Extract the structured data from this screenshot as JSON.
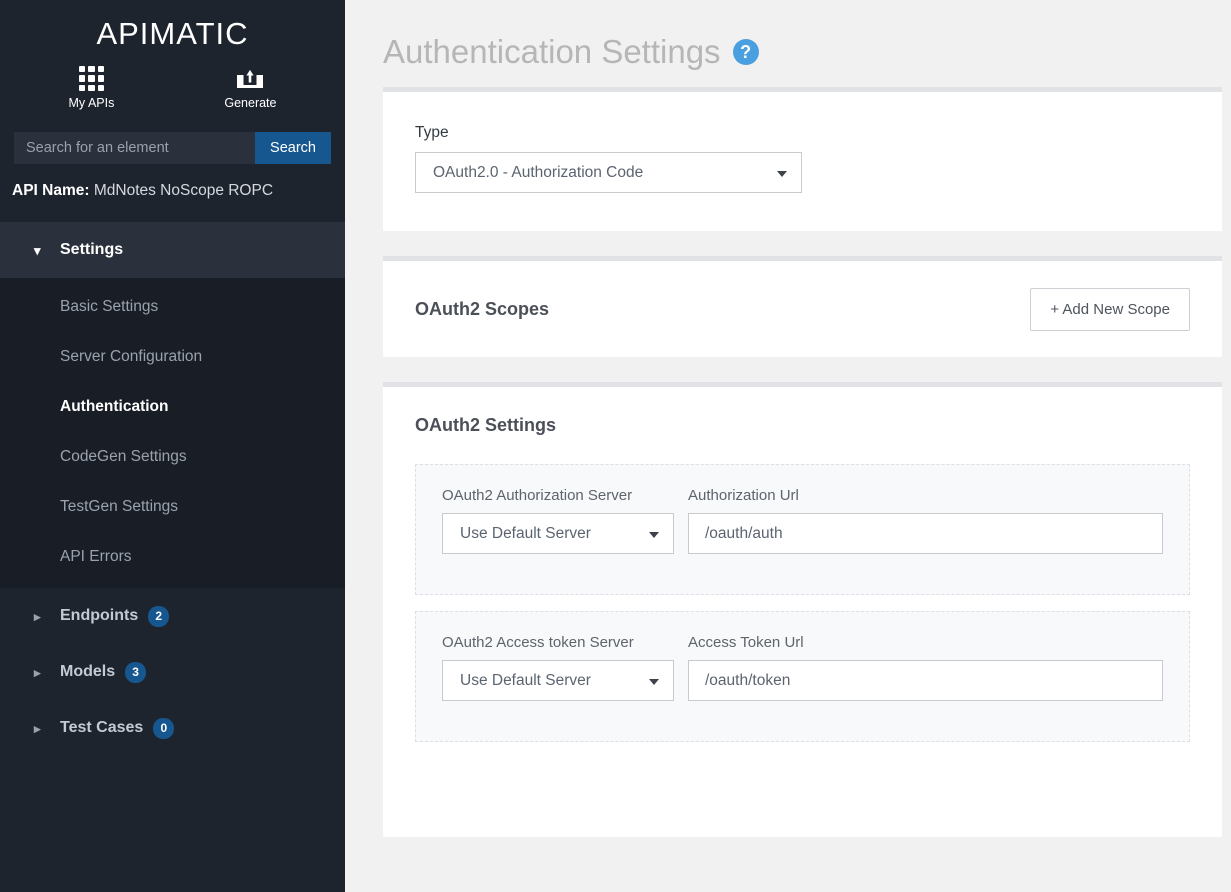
{
  "sidebar": {
    "brand": "APIMATIC",
    "quick_actions": [
      {
        "label": "My APIs",
        "icon": "grid-icon"
      },
      {
        "label": "Generate",
        "icon": "box-upload-icon"
      }
    ],
    "search": {
      "placeholder": "Search for an element",
      "value": "",
      "button_label": "Search"
    },
    "api_name_label": "API Name:",
    "api_name_value": "MdNotes NoScope ROPC",
    "nav": [
      {
        "label": "Settings",
        "expanded": true,
        "chevron": "chevron-down",
        "items": [
          {
            "label": "Basic Settings",
            "selected": false
          },
          {
            "label": "Server Configuration",
            "selected": false
          },
          {
            "label": "Authentication",
            "selected": true
          },
          {
            "label": "CodeGen Settings",
            "selected": false
          },
          {
            "label": "TestGen Settings",
            "selected": false
          },
          {
            "label": "API Errors",
            "selected": false
          }
        ]
      },
      {
        "label": "Endpoints",
        "expanded": false,
        "chevron": "chevron-right",
        "badge": "2"
      },
      {
        "label": "Models",
        "expanded": false,
        "chevron": "chevron-right",
        "badge": "3"
      },
      {
        "label": "Test Cases",
        "expanded": false,
        "chevron": "chevron-right",
        "badge": "0"
      }
    ],
    "colors": {
      "background": "#1e242e",
      "submenu_background": "#191e26",
      "accent": "#17578f"
    }
  },
  "main": {
    "page_title": "Authentication Settings",
    "help_icon": "question-mark-icon",
    "type_panel": {
      "label": "Type",
      "selected_value": "OAuth2.0 - Authorization Code"
    },
    "scopes_panel": {
      "title": "OAuth2 Scopes",
      "add_button_label": "+ Add New Scope"
    },
    "settings_panel": {
      "title": "OAuth2 Settings",
      "rows": [
        {
          "server_label": "OAuth2 Authorization Server",
          "server_value": "Use Default Server",
          "url_label": "Authorization Url",
          "url_value": "/oauth/auth"
        },
        {
          "server_label": "OAuth2 Access token Server",
          "server_value": "Use Default Server",
          "url_label": "Access Token Url",
          "url_value": "/oauth/token"
        }
      ]
    },
    "colors": {
      "page_background": "#f1f1f1",
      "panel_background": "#ffffff",
      "help_blue": "#4a9fe0"
    }
  }
}
